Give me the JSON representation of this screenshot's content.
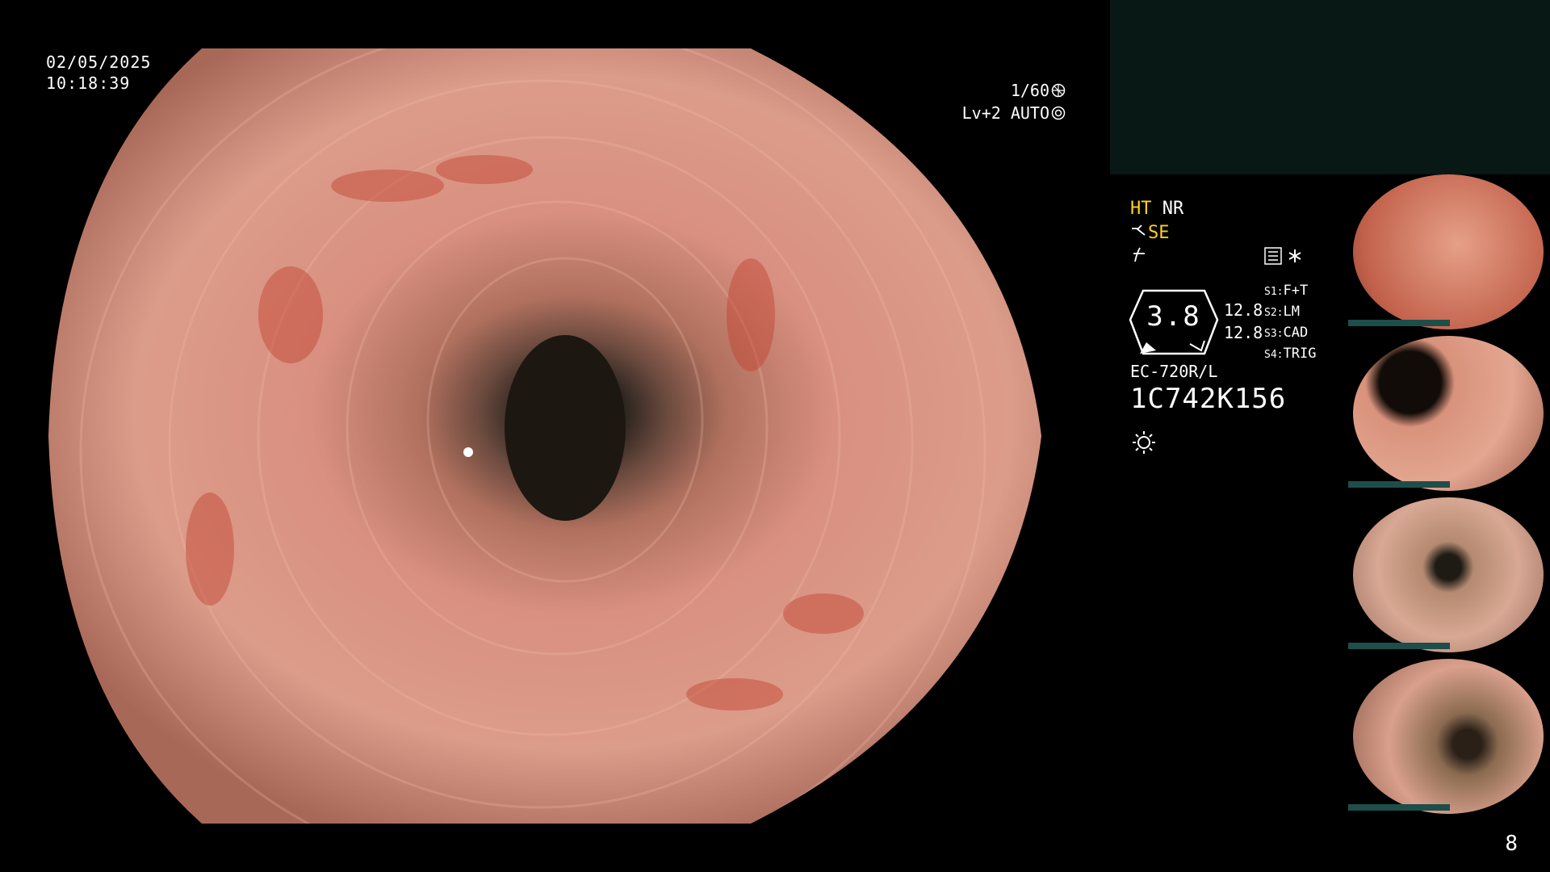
{
  "overlay": {
    "date": "02/05/2025",
    "time": "10:18:39",
    "shutter": "1/60",
    "exposure": "Lv+2 AUTO"
  },
  "status": {
    "line1_a": "HT",
    "line1_b": "NR",
    "line2": "SE"
  },
  "gauge": {
    "value": "3.8"
  },
  "gain": [
    "12.8",
    "12.8"
  ],
  "scope_keys": [
    {
      "key": "S1:",
      "label": "F+T"
    },
    {
      "key": "S2:",
      "label": "LM"
    },
    {
      "key": "S3:",
      "label": "CAD"
    },
    {
      "key": "S4:",
      "label": "TRIG"
    }
  ],
  "device": {
    "model": "EC-720R/L",
    "serial": "1C742K156"
  },
  "thumbnails": [
    {
      "name": "thumb-1"
    },
    {
      "name": "thumb-2"
    },
    {
      "name": "thumb-3"
    },
    {
      "name": "thumb-4"
    }
  ],
  "page_number": "8",
  "colors": {
    "accent_yellow": "#ffd21a",
    "panel_bg": "#071815",
    "mucosa": "#d98a7a"
  }
}
